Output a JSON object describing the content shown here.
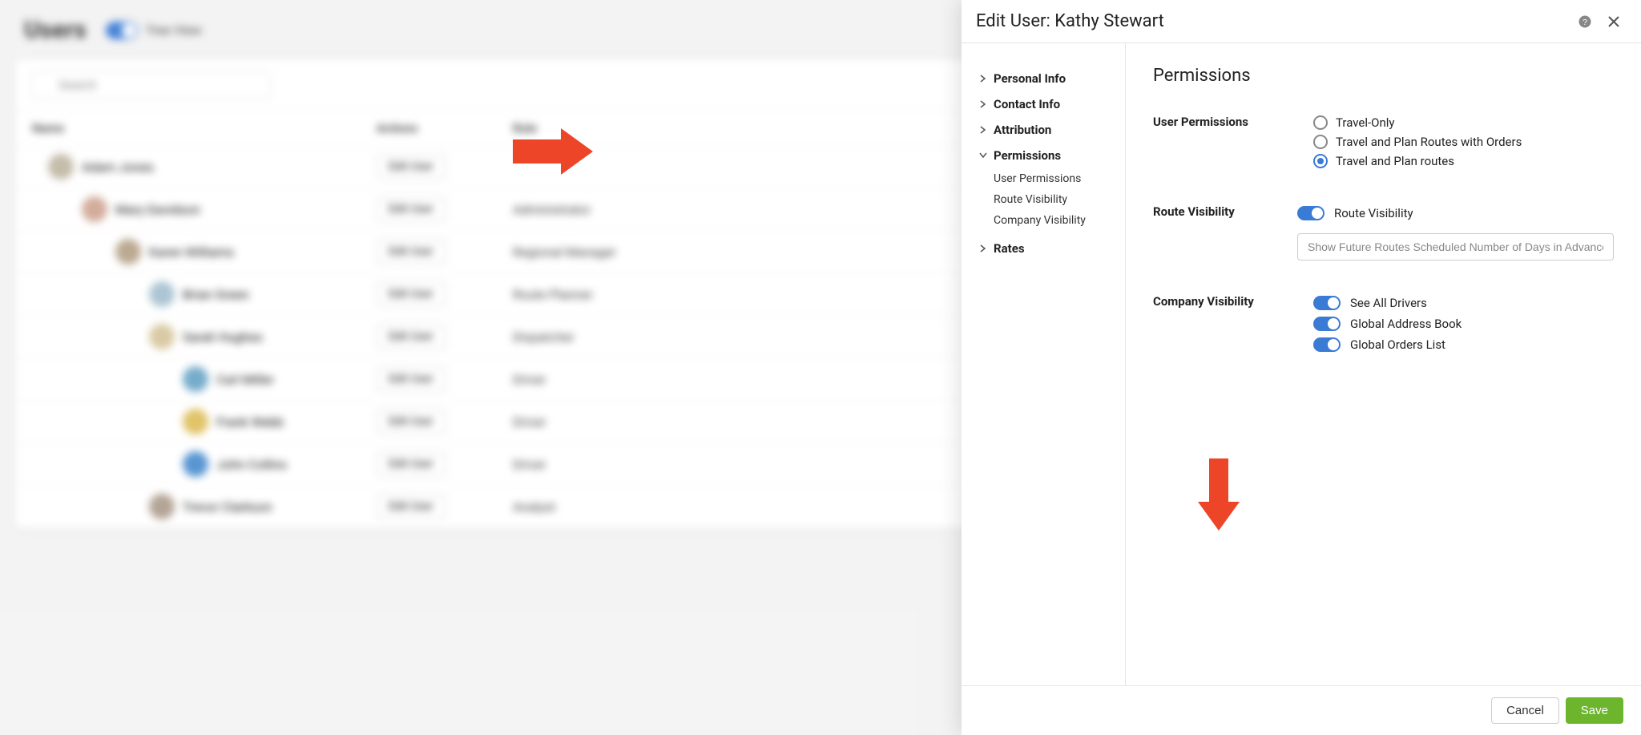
{
  "bg": {
    "title": "Users",
    "tree_view_label": "Tree View",
    "search_placeholder": "Search",
    "columns": {
      "name": "Name",
      "actions": "Actions",
      "role": "Role"
    },
    "rows": [
      {
        "indent": 0,
        "name": "Adam Jones",
        "action": "Edit User",
        "role": ""
      },
      {
        "indent": 1,
        "name": "Mary Davidson",
        "action": "Edit User",
        "role": "Administrator"
      },
      {
        "indent": 2,
        "name": "Karen Williams",
        "action": "Edit User",
        "role": "Regional Manager"
      },
      {
        "indent": 3,
        "name": "Brian Green",
        "action": "Edit User",
        "role": "Route Planner"
      },
      {
        "indent": 3,
        "name": "Sarah Hughes",
        "action": "Edit User",
        "role": "Dispatcher"
      },
      {
        "indent": 4,
        "name": "Carl Miller",
        "action": "Edit User",
        "role": "Driver"
      },
      {
        "indent": 4,
        "name": "Frank Webb",
        "action": "Edit User",
        "role": "Driver"
      },
      {
        "indent": 4,
        "name": "John Collins",
        "action": "Edit User",
        "role": "Driver"
      },
      {
        "indent": 3,
        "name": "Trevor Clarkson",
        "action": "Edit User",
        "role": "Analyst"
      }
    ]
  },
  "modal": {
    "title": "Edit User: Kathy Stewart",
    "sidebar": {
      "personal_info": "Personal Info",
      "contact_info": "Contact Info",
      "attribution": "Attribution",
      "permissions": "Permissions",
      "permissions_subs": {
        "user_permissions": "User Permissions",
        "route_visibility": "Route Visibility",
        "company_visibility": "Company Visibility"
      },
      "rates": "Rates"
    },
    "content": {
      "heading": "Permissions",
      "user_permissions_label": "User Permissions",
      "radios": {
        "travel_only": "Travel-Only",
        "travel_plan_orders": "Travel and Plan Routes with Orders",
        "travel_plan_routes": "Travel and Plan routes"
      },
      "route_visibility_label": "Route Visibility",
      "route_visibility_toggle": "Route Visibility",
      "route_future_placeholder": "Show Future Routes Scheduled Number of Days in Advance",
      "company_visibility_label": "Company Visibility",
      "toggles": {
        "see_all_drivers": "See All Drivers",
        "global_address_book": "Global Address Book",
        "global_orders_list": "Global Orders List"
      }
    },
    "footer": {
      "cancel": "Cancel",
      "save": "Save"
    }
  }
}
